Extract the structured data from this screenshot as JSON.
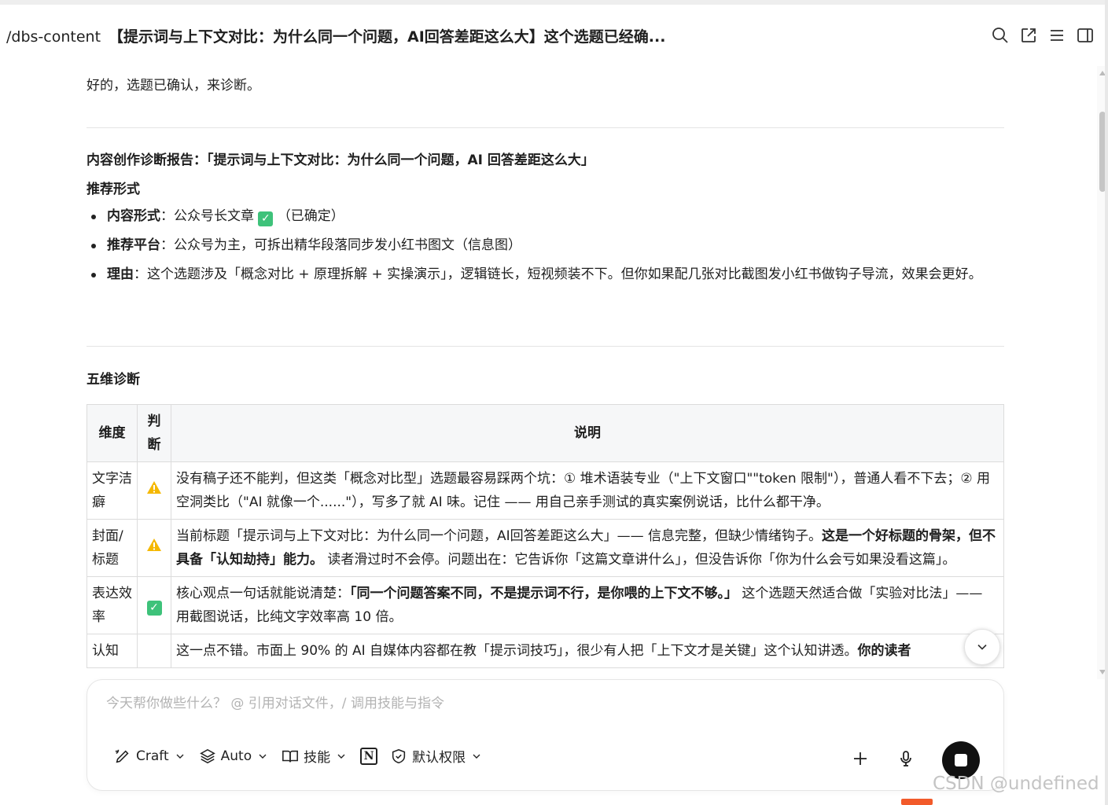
{
  "header": {
    "command": "/dbs-content",
    "title": "【提示词与上下文对比：为什么同一个问题，AI回答差距这么大】这个选题已经确..."
  },
  "message": {
    "intro": "好的，选题已确认，来诊断。",
    "report_title": "内容创作诊断报告：「提示词与上下文对比：为什么同一个问题，AI 回答差距这么大」",
    "recommend_heading": "推荐形式",
    "bullets": [
      {
        "label": "内容形式",
        "sep": "：",
        "text": "公众号长文章 ",
        "suffix": "（已确定）"
      },
      {
        "label": "推荐平台",
        "sep": "：",
        "text": "公众号为主，可拆出精华段落同步发小红书图文（信息图）"
      },
      {
        "label": "理由",
        "sep": "：",
        "text": "这个选题涉及「概念对比 + 原理拆解 + 实操演示」，逻辑链长，短视频装不下。但你如果配几张对比截图发小红书做钩子导流，效果会更好。"
      }
    ],
    "five_heading": "五维诊断",
    "table": {
      "headers": [
        "维度",
        "判断",
        "说明"
      ],
      "rows": [
        {
          "dim": "文字洁癖",
          "verdict": "warning",
          "desc": [
            {
              "t": "没有稿子还不能判，但这类「概念对比型」选题最容易踩两个坑：① 堆术语装专业（\"上下文窗口\"\"token 限制\"），普通人看不下去；② 用空洞类比（\"AI 就像一个......\"），写多了就 AI 味。记住 —— 用自己亲手测试的真实案例说话，比什么都干净。",
              "b": false
            }
          ]
        },
        {
          "dim": "封面/标题",
          "verdict": "warning",
          "desc": [
            {
              "t": "当前标题「提示词与上下文对比：为什么同一个问题，AI回答差距这么大」—— 信息完整，但缺少情绪钩子。",
              "b": false
            },
            {
              "t": "这是一个好标题的骨架，但不具备「认知劫持」能力。",
              "b": true
            },
            {
              "t": " 读者滑过时不会停。问题出在：它告诉你「这篇文章讲什么」，但没告诉你「你为什么会亏如果没看这篇」。",
              "b": false
            }
          ]
        },
        {
          "dim": "表达效率",
          "verdict": "pass",
          "desc": [
            {
              "t": "核心观点一句话就能说清楚：",
              "b": false
            },
            {
              "t": "「同一个问题答案不同，不是提示词不行，是你喂的上下文不够。」",
              "b": true
            },
            {
              "t": " 这个选题天然适合做「实验对比法」—— 用截图说话，比纯文字效率高 10 倍。",
              "b": false
            }
          ]
        },
        {
          "dim": "认知",
          "verdict": "",
          "desc": [
            {
              "t": "这一点不错。市面上 90% 的 AI 自媒体内容都在教「提示词技巧」，很少有人把「上下文才是关键」这个认知讲透。",
              "b": false
            },
            {
              "t": "你的读者",
              "b": true
            }
          ]
        }
      ]
    }
  },
  "composer": {
    "placeholder": "今天帮你做些什么？ @ 引用对话文件，/ 调用技能与指令",
    "tools": {
      "craft": "Craft",
      "auto": "Auto",
      "skills": "技能",
      "notion": "N",
      "permission": "默认权限"
    }
  },
  "watermark": "CSDN @undefined",
  "colors": {
    "check_green": "#3ec27a",
    "warning_yellow": "#f5b800",
    "brand_orange": "#f25a2a"
  }
}
